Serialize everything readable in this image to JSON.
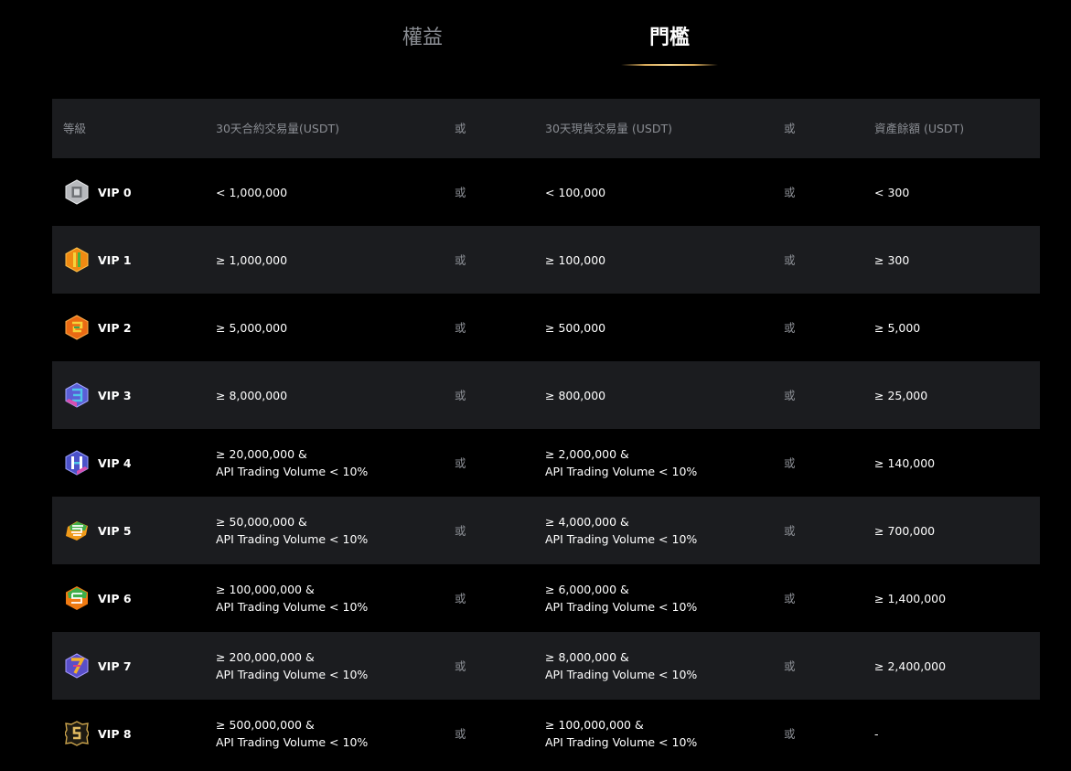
{
  "tabs": [
    {
      "label": "權益",
      "active": false
    },
    {
      "label": "門檻",
      "active": true
    }
  ],
  "colors": {
    "background": "#000000",
    "row_shade": "#1b1c1f",
    "muted_text": "#8a8d93",
    "accent_gold": "#d8aa5a"
  },
  "table": {
    "headers": {
      "level": "等級",
      "futures": "30天合約交易量(USDT)",
      "or1": "或",
      "spot": "30天現貨交易量 (USDT)",
      "or2": "或",
      "assets": "資產餘額 (USDT)"
    },
    "rows": [
      {
        "level": "VIP 0",
        "icon": "vip0-badge-icon",
        "futures": [
          "< 1,000,000"
        ],
        "or1": "或",
        "spot": [
          "< 100,000"
        ],
        "or2": "或",
        "assets": "< 300"
      },
      {
        "level": "VIP 1",
        "icon": "vip1-badge-icon",
        "futures": [
          "≥ 1,000,000"
        ],
        "or1": "或",
        "spot": [
          "≥ 100,000"
        ],
        "or2": "或",
        "assets": "≥ 300"
      },
      {
        "level": "VIP 2",
        "icon": "vip2-badge-icon",
        "futures": [
          "≥ 5,000,000"
        ],
        "or1": "或",
        "spot": [
          "≥ 500,000"
        ],
        "or2": "或",
        "assets": "≥ 5,000"
      },
      {
        "level": "VIP 3",
        "icon": "vip3-badge-icon",
        "futures": [
          "≥ 8,000,000"
        ],
        "or1": "或",
        "spot": [
          "≥ 800,000"
        ],
        "or2": "或",
        "assets": "≥ 25,000"
      },
      {
        "level": "VIP 4",
        "icon": "vip4-badge-icon",
        "futures": [
          "≥ 20,000,000 &",
          "API Trading Volume < 10%"
        ],
        "or1": "或",
        "spot": [
          "≥ 2,000,000 &",
          "API Trading Volume < 10%"
        ],
        "or2": "或",
        "assets": "≥ 140,000"
      },
      {
        "level": "VIP 5",
        "icon": "vip5-badge-icon",
        "futures": [
          "≥ 50,000,000 &",
          "API Trading Volume < 10%"
        ],
        "or1": "或",
        "spot": [
          "≥ 4,000,000 &",
          "API Trading Volume < 10%"
        ],
        "or2": "或",
        "assets": "≥ 700,000"
      },
      {
        "level": "VIP 6",
        "icon": "vip6-badge-icon",
        "futures": [
          "≥ 100,000,000 &",
          "API Trading Volume < 10%"
        ],
        "or1": "或",
        "spot": [
          "≥ 6,000,000 &",
          "API Trading Volume < 10%"
        ],
        "or2": "或",
        "assets": "≥ 1,400,000"
      },
      {
        "level": "VIP 7",
        "icon": "vip7-badge-icon",
        "futures": [
          "≥ 200,000,000 &",
          "API Trading Volume < 10%"
        ],
        "or1": "或",
        "spot": [
          "≥ 8,000,000 &",
          "API Trading Volume < 10%"
        ],
        "or2": "或",
        "assets": "≥ 2,400,000"
      },
      {
        "level": "VIP 8",
        "icon": "vip8-badge-icon",
        "futures": [
          "≥ 500,000,000 &",
          "API Trading Volume < 10%"
        ],
        "or1": "或",
        "spot": [
          "≥ 100,000,000 &",
          "API Trading Volume < 10%"
        ],
        "or2": "或",
        "assets": "-"
      }
    ]
  }
}
